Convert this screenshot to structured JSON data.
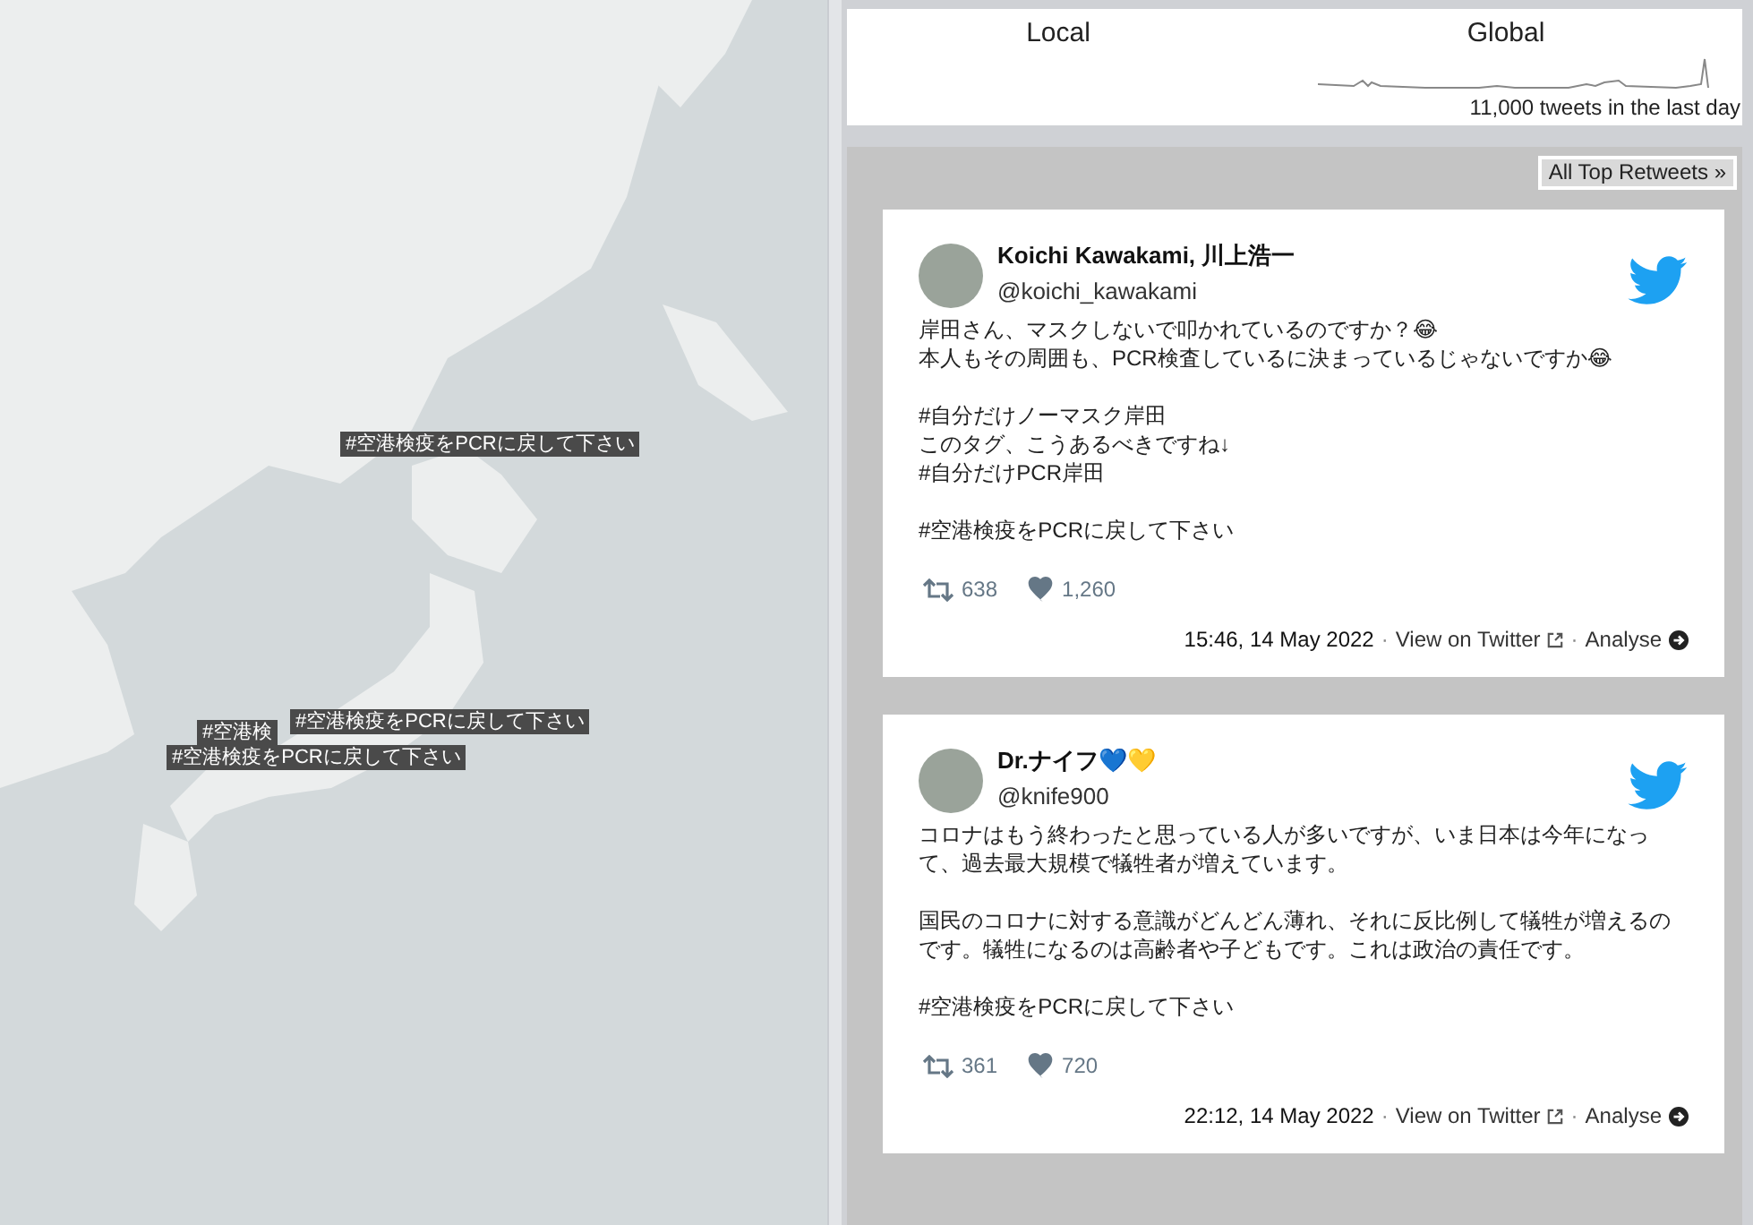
{
  "map": {
    "labels": [
      {
        "text": "#空港検疫をPCRに戻して下さい"
      },
      {
        "text": "#空港検"
      },
      {
        "text": "#空港検疫をPCRに戻して下さい"
      },
      {
        "text": "#空港検疫をPCRに戻して下さい"
      }
    ]
  },
  "stats": {
    "local_title": "Local",
    "global_title": "Global",
    "global_caption": "11,000 tweets in the last day"
  },
  "retweets": {
    "all_button": "All Top Retweets »",
    "tweets": [
      {
        "name": "Koichi Kawakami, 川上浩一",
        "handle": "@koichi_kawakami",
        "paragraphs": [
          [
            "岸田さん、マスクしないで叩かれているのですか？😂",
            "本人もその周囲も、PCR検査しているに決まっているじゃないですか😂"
          ],
          [
            "#自分だけノーマスク岸田",
            "このタグ、こうあるべきですね↓",
            "#自分だけPCR岸田"
          ],
          [
            "#空港検疫をPCRに戻して下さい"
          ]
        ],
        "retweets": "638",
        "likes": "1,260",
        "time": "15:46, 14 May 2022",
        "sep1": "·",
        "link": "View on Twitter",
        "sep2": "·",
        "analyse": "Analyse"
      },
      {
        "name": "Dr.ナイフ💙💛",
        "handle": "@knife900",
        "paragraphs": [
          [
            "コロナはもう終わったと思っている人が多いですが、いま日本は今年になって、過去最大規模で犠牲者が増えています。"
          ],
          [
            "国民のコロナに対する意識がどんどん薄れ、それに反比例して犠牲が増えるのです。犠牲になるのは高齢者や子どもです。これは政治の責任です。"
          ],
          [
            "#空港検疫をPCRに戻して下さい"
          ]
        ],
        "retweets": "361",
        "likes": "720",
        "time": "22:12, 14 May 2022",
        "sep1": "·",
        "link": "View on Twitter",
        "sep2": "·",
        "analyse": "Analyse"
      }
    ]
  }
}
